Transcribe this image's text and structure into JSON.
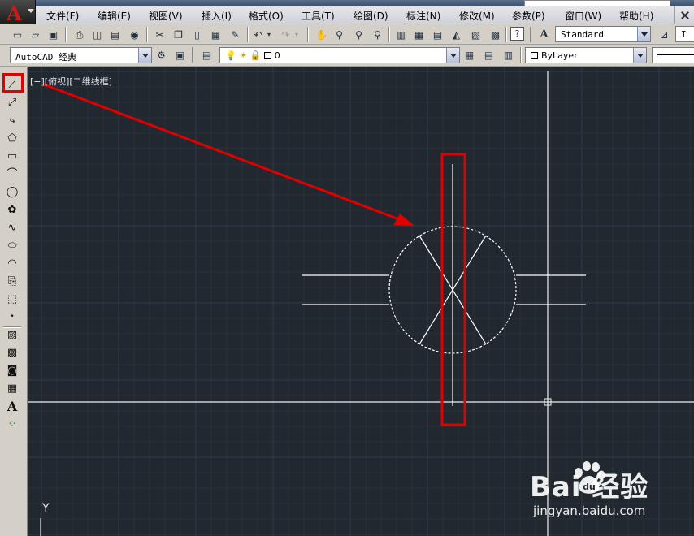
{
  "menu": {
    "items": [
      "文件(F)",
      "编辑(E)",
      "视图(V)",
      "插入(I)",
      "格式(O)",
      "工具(T)",
      "绘图(D)",
      "标注(N)",
      "修改(M)",
      "参数(P)",
      "窗口(W)",
      "帮助(H)"
    ]
  },
  "toolbar": {
    "text_style": "Standard",
    "dim_style_partial": "I"
  },
  "layers_toolbar": {
    "workspace": "AutoCAD 经典",
    "current_layer": "0",
    "color": "ByLayer"
  },
  "viewport": {
    "label": "[−][俯视][二维线框]"
  },
  "ucs": {
    "y_label": "Y"
  },
  "watermark": {
    "brand": "Bai  经验",
    "url": "jingyan.baidu.com"
  },
  "colors": {
    "canvas_bg": "#212830",
    "grid_minor": "#2a3038",
    "grid_major": "#323a44",
    "geometry": "#ffffff",
    "annotation": "#e00000",
    "toolbar_bg": "#d4d0c8"
  },
  "icons": {
    "app_button": "autocad-logo-icon",
    "highlighted_tool": "line-tool-icon"
  }
}
